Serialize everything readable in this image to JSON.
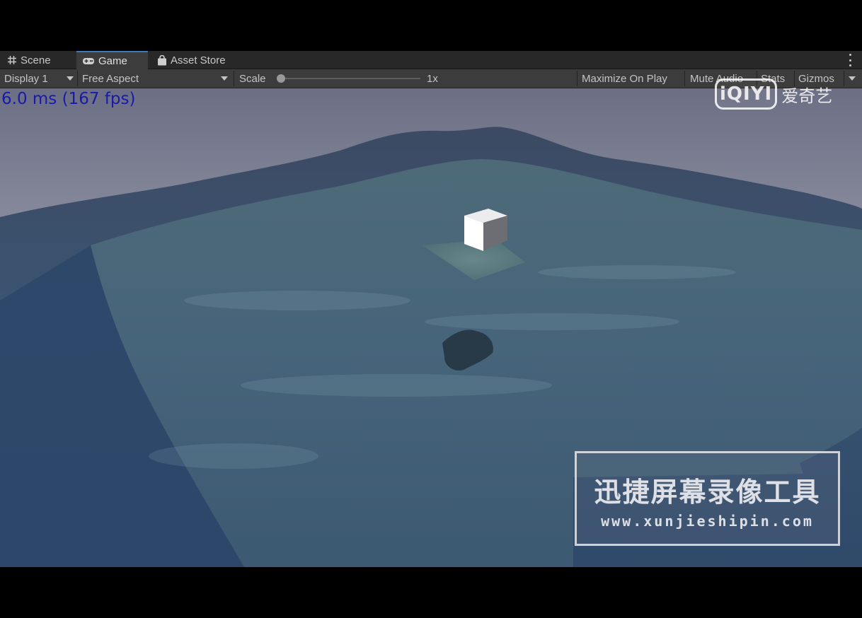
{
  "tabs": [
    {
      "label": "Scene",
      "icon": "grid-hash-icon",
      "active": false
    },
    {
      "label": "Game",
      "icon": "gamepad-icon",
      "active": true
    },
    {
      "label": "Asset Store",
      "icon": "shopping-bag-icon",
      "active": false
    }
  ],
  "toolbar": {
    "display": "Display 1",
    "aspect": "Free Aspect",
    "scale_label": "Scale",
    "scale_value": "1x",
    "scale_fraction": 0.0,
    "maximize": "Maximize On Play",
    "mute": "Mute Audio",
    "stats": "Stats",
    "gizmos": "Gizmos"
  },
  "game": {
    "fps_text": "6.0 ms (167 fps)"
  },
  "watermarks": {
    "iqiyi_logo": "iQIYI",
    "iqiyi_text": "爱奇艺",
    "recorder_title": "迅捷屏幕录像工具",
    "recorder_url": "www.xunjieshipin.com"
  },
  "colors": {
    "accent": "#3a79bb",
    "fps_text": "#1a1aa8",
    "water": "#3e5a6a"
  }
}
